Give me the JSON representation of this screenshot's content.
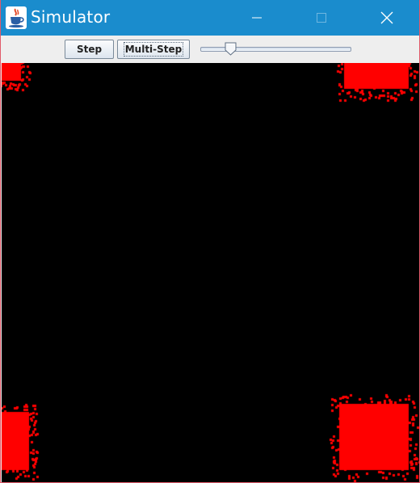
{
  "window": {
    "title": "Simulator",
    "titlebar_color": "#1a8ccd",
    "icons": {
      "app": "java-cup-icon",
      "minimize": "minimize-icon",
      "maximize": "maximize-icon",
      "close": "close-icon"
    }
  },
  "toolbar": {
    "step_label": "Step",
    "multi_step_label": "Multi-Step",
    "speed_slider_value_fraction": 0.17
  },
  "simulation": {
    "background_color": "#000000",
    "particle_color": "#ff0000"
  }
}
